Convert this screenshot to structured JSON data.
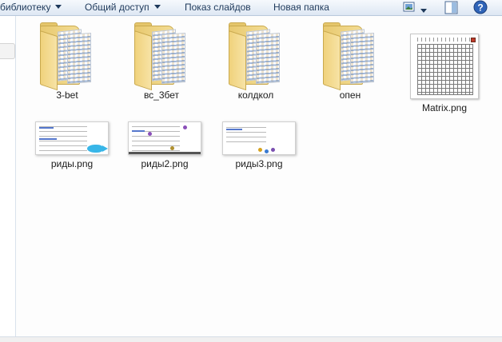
{
  "toolbar": {
    "library_label": "библиотеку",
    "share_label": "Общий доступ",
    "slideshow_label": "Показ слайдов",
    "new_folder_label": "Новая папка",
    "view_icon": "view-icon",
    "pane_icon": "preview-pane-icon",
    "help_icon": "help-icon"
  },
  "files": [
    {
      "name": "3-bet",
      "type": "folder"
    },
    {
      "name": "вс_3бет",
      "type": "folder"
    },
    {
      "name": "колдкол",
      "type": "folder"
    },
    {
      "name": "опен",
      "type": "folder"
    },
    {
      "name": "Matrix.png",
      "type": "image"
    },
    {
      "name": "риды.png",
      "type": "image"
    },
    {
      "name": "риды2.png",
      "type": "image"
    },
    {
      "name": "риды3.png",
      "type": "image"
    }
  ],
  "colors": {
    "toolbar_text": "#1e395b",
    "help_blue": "#2f64b8",
    "folder_yellow": "#f0d27c"
  }
}
